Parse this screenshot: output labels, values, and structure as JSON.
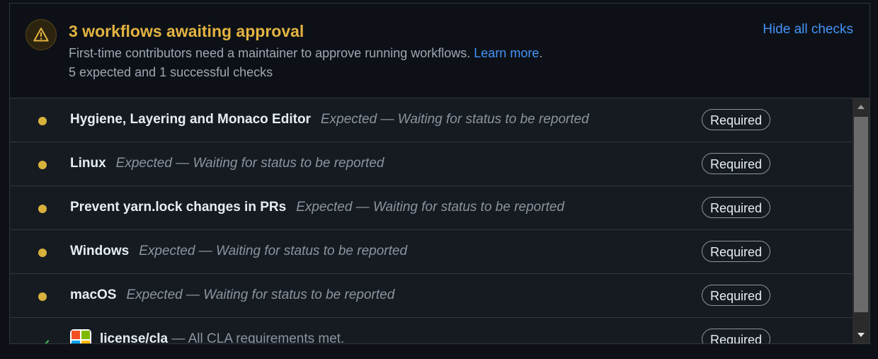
{
  "header": {
    "title": "3 workflows awaiting approval",
    "subtitle": "First-time contributors need a maintainer to approve running workflows.",
    "learn_more": "Learn more",
    "subtitle_end": ".",
    "summary": "5 expected and 1 successful checks",
    "hide_checks": "Hide all checks",
    "icon": "alert-icon"
  },
  "checks": [
    {
      "name": "Hygiene, Layering and Monaco Editor",
      "description": "Expected — Waiting for status to be reported",
      "badge": "Required",
      "status": "pending"
    },
    {
      "name": "Linux",
      "description": "Expected — Waiting for status to be reported",
      "badge": "Required",
      "status": "pending"
    },
    {
      "name": "Prevent yarn.lock changes in PRs",
      "description": "Expected — Waiting for status to be reported",
      "badge": "Required",
      "status": "pending"
    },
    {
      "name": "Windows",
      "description": "Expected — Waiting for status to be reported",
      "badge": "Required",
      "status": "pending"
    },
    {
      "name": "macOS",
      "description": "Expected — Waiting for status to be reported",
      "badge": "Required",
      "status": "pending"
    },
    {
      "name": "license/cla",
      "description": "— All CLA requirements met.",
      "badge": "Required",
      "status": "success"
    }
  ],
  "colors": {
    "pending": "#d8b13d",
    "success": "#3fb950",
    "warning": "#e3b341",
    "link": "#4493f8"
  }
}
